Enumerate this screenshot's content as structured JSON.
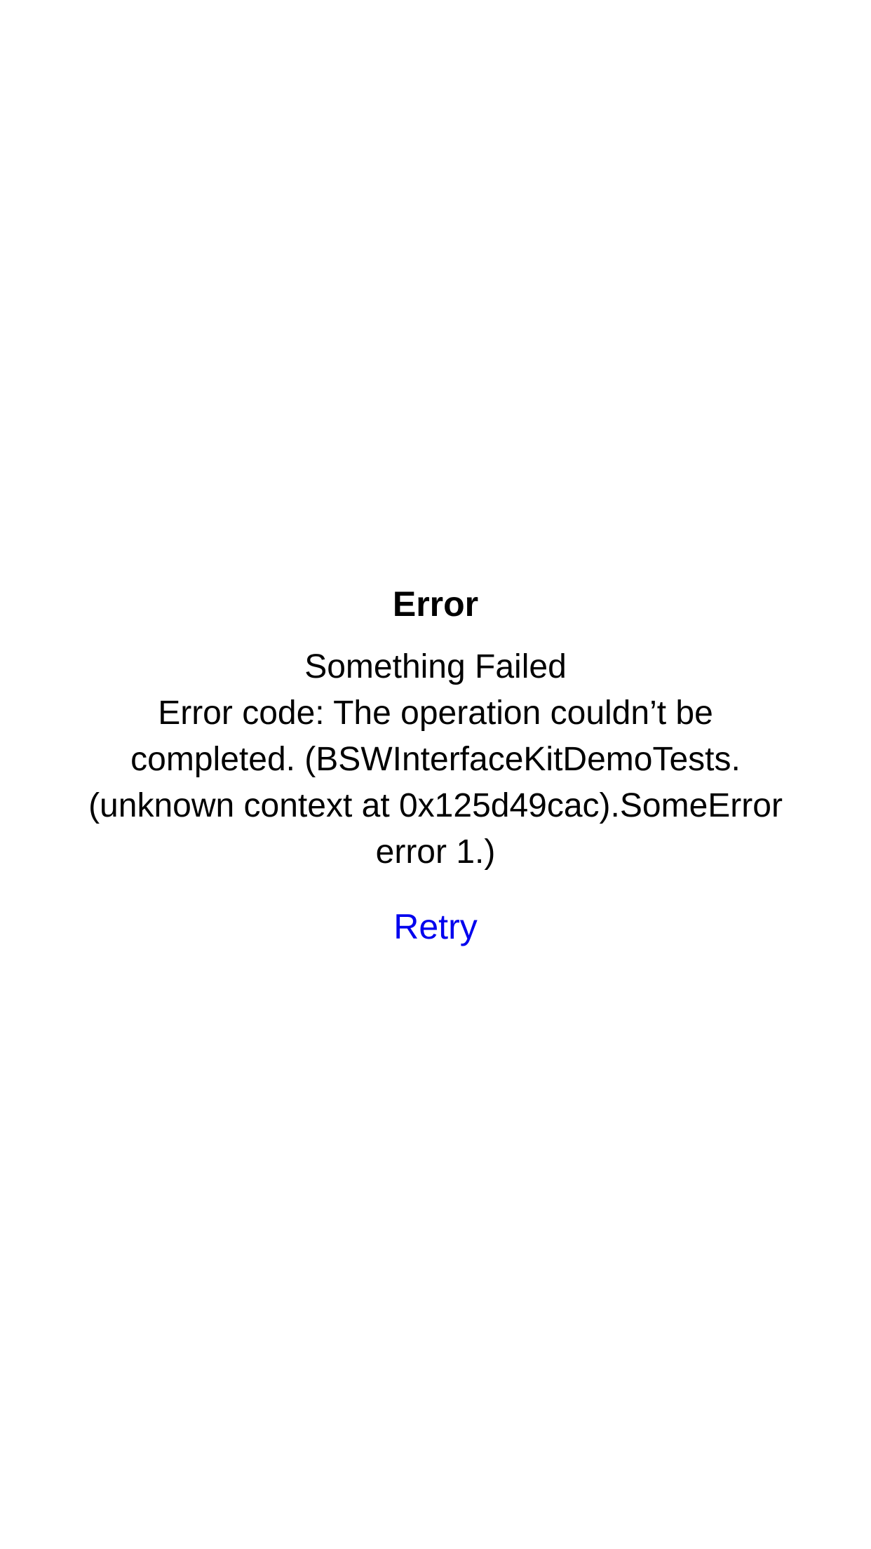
{
  "error": {
    "title": "Error",
    "message_lines": [
      "Something Failed",
      "Error code: The operation couldn’t be",
      "completed. (BSWInterfaceKitDemoTests.",
      "(unknown context at 0x125d49cac).SomeError",
      "error 1.)"
    ],
    "retry_label": "Retry"
  },
  "colors": {
    "background": "#FFFFFF",
    "text": "#000000",
    "link": "#0000EE"
  }
}
